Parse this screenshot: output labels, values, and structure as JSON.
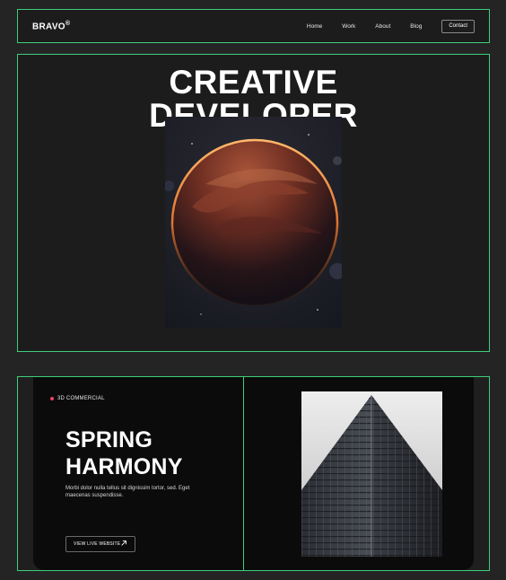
{
  "nav": {
    "logo": "BRAVO",
    "logo_mark": "®",
    "links": [
      "Home",
      "Work",
      "About",
      "Blog"
    ],
    "contact": "Contact"
  },
  "hero": {
    "line1": "CREATIVE",
    "line2": "DEVELOPER",
    "image": "planet-image"
  },
  "project": {
    "tag": "3D COMMERCIAL",
    "title_line1": "SPRING",
    "title_line2": "HARMONY",
    "description": "Morbi dolor nulla tellus sit dignissim tortor, sed. Eget maecenas suspendisse.",
    "cta": "VIEW LIVE WEBSITE",
    "cta_icon": "arrow-up-right-icon",
    "image": "skyscraper-image"
  },
  "colors": {
    "accent_outline": "#3ecf7a",
    "tag_dot": "#e8455d",
    "background": "#242424"
  }
}
